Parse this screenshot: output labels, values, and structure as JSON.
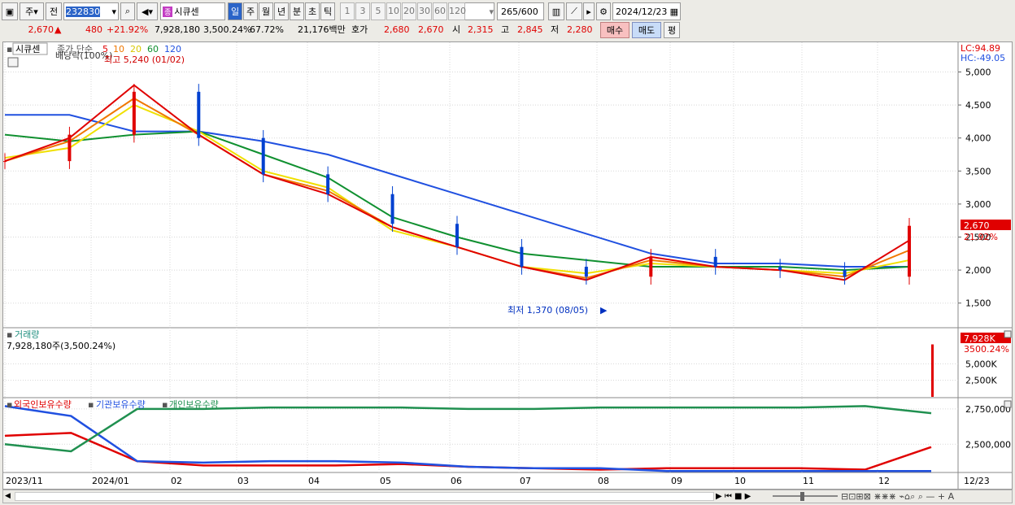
{
  "toolbar": {
    "market": "주",
    "prev": "전",
    "code": "232830",
    "name": "시큐센",
    "name_badge": "종",
    "periods": [
      "일",
      "주",
      "월",
      "년",
      "분",
      "초",
      "틱"
    ],
    "active_period": "일",
    "intervals": [
      "1",
      "3",
      "5",
      "10",
      "20",
      "30",
      "60",
      "120"
    ],
    "count": "265",
    "count_total": "/600",
    "date": "2024/12/23"
  },
  "quote": {
    "price": "2,670",
    "up_mark": "▲",
    "change": "480",
    "change_pct": "+21.92%",
    "volume": "7,928,180",
    "volume_pct": "3,500.24%",
    "turnover_rate": "67.72%",
    "amount": "21,176백만",
    "hoga_label": "호가",
    "ask": "2,680",
    "bid": "2,670",
    "open_label": "시",
    "open": "2,315",
    "high_label": "고",
    "high": "2,845",
    "low_label": "저",
    "low": "2,280",
    "buy_label": "매수",
    "sell_label": "매도",
    "eval_label": "평"
  },
  "price_pane": {
    "tab": "시큐센",
    "legend_prefix": "종가 단순",
    "ma_labels": [
      "5",
      "10",
      "20",
      "60",
      "120"
    ],
    "ma_colors": [
      "#e00000",
      "#f07800",
      "#f0e000",
      "#109030",
      "#2050e0"
    ],
    "lc": "LC:94.89",
    "hc": "HC:-49.05",
    "high_note": "최고 5,240 (01/02)",
    "low_note": "최저 1,370 (08/05)",
    "badge_note": "배당락(100%)",
    "last_price": "2,670",
    "last_pct": "21.92%",
    "y_ticks": [
      "5,000",
      "4,500",
      "4,000",
      "3,500",
      "3,000",
      "2,500",
      "2,000",
      "1,500"
    ]
  },
  "volume_pane": {
    "title": "거래량",
    "value": "7,928,180주(3,500.24%)",
    "badge": "7,928K",
    "badge_pct": "3500.24%",
    "y_ticks": [
      "5,000K",
      "2,500K"
    ]
  },
  "holdings_pane": {
    "legend": [
      "외국인보유수량",
      "기관보유수량",
      "개인보유수량"
    ],
    "colors": [
      "#e00000",
      "#2050e0",
      "#209050"
    ],
    "y_ticks": [
      "2,750,000",
      "2,500,000"
    ]
  },
  "x_axis": {
    "labels": [
      "2023/11",
      "2024/01",
      "02",
      "03",
      "04",
      "05",
      "06",
      "07",
      "08",
      "09",
      "10",
      "11",
      "12",
      "12/23"
    ]
  },
  "chart_data": [
    {
      "type": "candlestick",
      "title": "시큐센",
      "y_range": [
        1300,
        5250
      ],
      "x": [
        "2023/11",
        "2023/12",
        "2024/01",
        "02",
        "03",
        "04",
        "05",
        "06",
        "07",
        "08",
        "09",
        "10",
        "11",
        "12",
        "12/23"
      ],
      "close_approx": [
        3650,
        4050,
        4700,
        4000,
        3450,
        3150,
        2700,
        2350,
        2050,
        1900,
        2200,
        2050,
        2000,
        1900,
        2670
      ],
      "ma_series": [
        {
          "name": "5",
          "values": [
            3650,
            4000,
            4800,
            4050,
            3450,
            3150,
            2650,
            2350,
            2050,
            1850,
            2200,
            2050,
            2000,
            1850,
            2450
          ]
        },
        {
          "name": "10",
          "values": [
            3650,
            3950,
            4600,
            4050,
            3450,
            3200,
            2650,
            2350,
            2050,
            1880,
            2150,
            2050,
            2000,
            1900,
            2300
          ]
        },
        {
          "name": "20",
          "values": [
            3700,
            3850,
            4500,
            4100,
            3500,
            3250,
            2600,
            2350,
            2050,
            1950,
            2100,
            2050,
            2000,
            1950,
            2150
          ]
        },
        {
          "name": "60",
          "values": [
            4050,
            3950,
            4050,
            4100,
            3750,
            3400,
            2800,
            2500,
            2250,
            2150,
            2050,
            2050,
            2050,
            2000,
            2050
          ]
        },
        {
          "name": "120",
          "values": [
            4350,
            4350,
            4100,
            4100,
            3950,
            3750,
            3450,
            3150,
            2850,
            2550,
            2250,
            2100,
            2100,
            2050,
            2050
          ]
        }
      ]
    },
    {
      "type": "bar",
      "title": "거래량",
      "y_range": [
        0,
        10000
      ],
      "unit": "K",
      "last_value_k": 7928
    },
    {
      "type": "line",
      "title": "보유수량",
      "y_range": [
        2300000,
        2830000
      ],
      "series": [
        {
          "name": "외국인보유수량",
          "values": [
            2560000,
            2580000,
            2380000,
            2350000,
            2350000,
            2350000,
            2360000,
            2340000,
            2330000,
            2320000,
            2330000,
            2330000,
            2330000,
            2320000,
            2480000
          ]
        },
        {
          "name": "기관보유수량",
          "values": [
            2770000,
            2700000,
            2380000,
            2370000,
            2380000,
            2380000,
            2370000,
            2340000,
            2330000,
            2330000,
            2310000,
            2310000,
            2310000,
            2310000,
            2310000
          ]
        },
        {
          "name": "개인보유수량",
          "values": [
            2500000,
            2450000,
            2750000,
            2750000,
            2760000,
            2760000,
            2760000,
            2750000,
            2750000,
            2760000,
            2760000,
            2760000,
            2760000,
            2770000,
            2720000
          ]
        }
      ]
    }
  ]
}
